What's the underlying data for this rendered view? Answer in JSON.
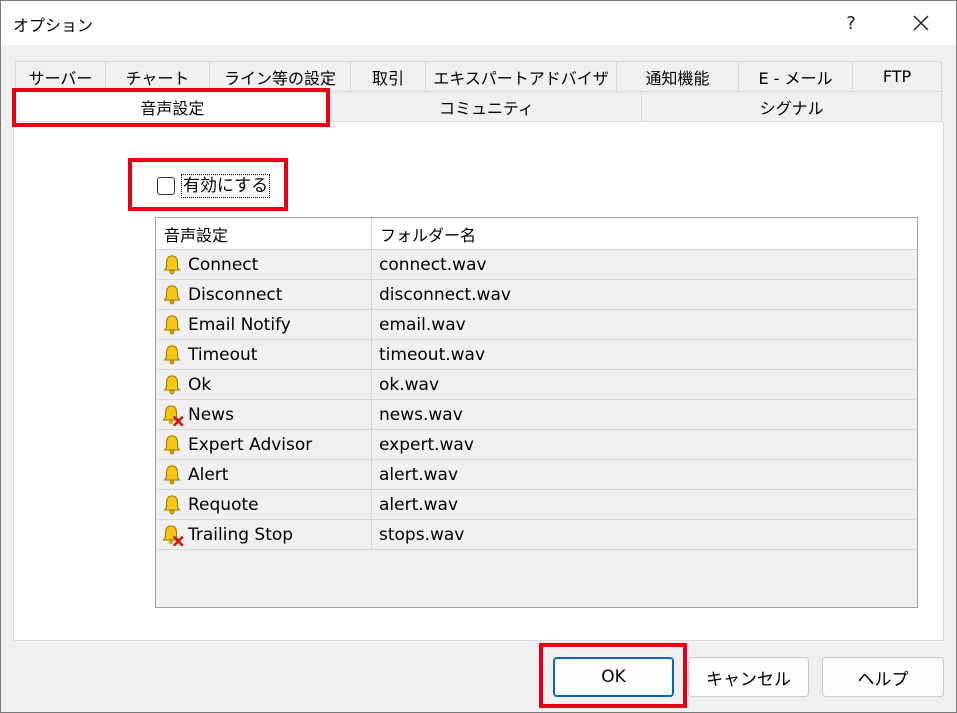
{
  "window": {
    "title": "オプション",
    "help_glyph": "?",
    "close_glyph": "✕"
  },
  "tabs_row1": [
    "サーバー",
    "チャート",
    "ライン等の設定",
    "取引",
    "エキスパートアドバイザ",
    "通知機能",
    "E - メール",
    "FTP"
  ],
  "tabs_row2": [
    "音声設定",
    "コミュニティ",
    "シグナル"
  ],
  "active_tab": "音声設定",
  "enable": {
    "label": "有効にする",
    "checked": false
  },
  "table": {
    "headers": [
      "音声設定",
      "フォルダー名"
    ],
    "rows": [
      {
        "event": "Connect",
        "file": "connect.wav",
        "icon": "bell-icon"
      },
      {
        "event": "Disconnect",
        "file": "disconnect.wav",
        "icon": "bell-icon"
      },
      {
        "event": "Email Notify",
        "file": "email.wav",
        "icon": "bell-icon"
      },
      {
        "event": "Timeout",
        "file": "timeout.wav",
        "icon": "bell-icon"
      },
      {
        "event": "Ok",
        "file": "ok.wav",
        "icon": "bell-icon"
      },
      {
        "event": "News",
        "file": "news.wav",
        "icon": "bell-disabled-icon"
      },
      {
        "event": "Expert Advisor",
        "file": "expert.wav",
        "icon": "bell-icon"
      },
      {
        "event": "Alert",
        "file": "alert.wav",
        "icon": "bell-icon"
      },
      {
        "event": "Requote",
        "file": "alert.wav",
        "icon": "bell-icon"
      },
      {
        "event": "Trailing Stop",
        "file": "stops.wav",
        "icon": "bell-disabled-icon"
      }
    ]
  },
  "buttons": {
    "ok": "OK",
    "cancel": "キャンセル",
    "help": "ヘルプ"
  },
  "colors": {
    "highlight": "#e60012",
    "accent": "#0067c0"
  }
}
